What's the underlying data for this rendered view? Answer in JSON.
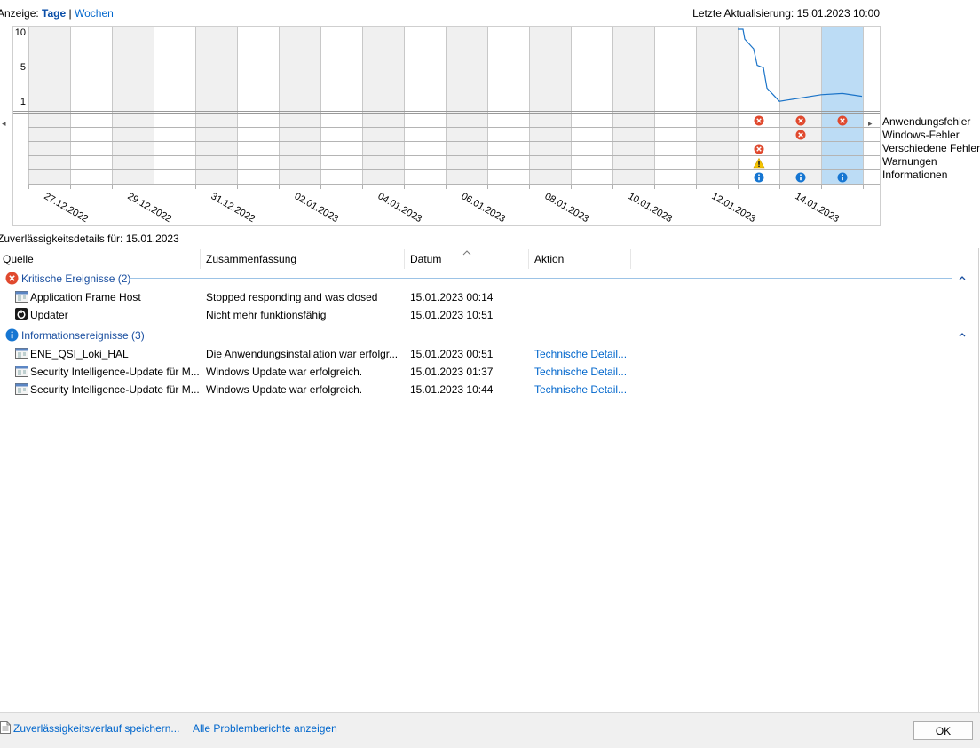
{
  "header": {
    "view_label": "Anzeige:",
    "view_days": "Tage",
    "view_sep": "|",
    "view_weeks": "Wochen",
    "last_update": "Letzte Aktualisierung: 15.01.2023 10:00"
  },
  "chart": {
    "y_labels": [
      "10",
      "5",
      "1"
    ],
    "legend": [
      "Anwendungsfehler",
      "Windows-Fehler",
      "Verschiedene Fehler",
      "Warnungen",
      "Informationen"
    ],
    "date_labels": [
      "27.12.2022",
      "29.12.2022",
      "31.12.2022",
      "02.01.2023",
      "04.01.2023",
      "06.01.2023",
      "08.01.2023",
      "10.01.2023",
      "12.01.2023",
      "14.01.2023"
    ],
    "nav_left": "◂",
    "nav_right": "▸",
    "selected_day": "15.01.2023",
    "line_color": "#1a73c8",
    "selection_color": "#bcdcf5"
  },
  "chart_data": {
    "type": "line",
    "title": "",
    "xlabel": "",
    "ylabel": "",
    "ylim": [
      1,
      10
    ],
    "x": [
      "13.01.2023",
      "14.01.2023",
      "15.01.2023"
    ],
    "series": [
      {
        "values": [
          10.0,
          1.2,
          2.0
        ]
      }
    ],
    "event_markers": [
      {
        "day": "13.01.2023",
        "events": [
          "Anwendungsfehler",
          "Verschiedene Fehler",
          "Warnungen",
          "Informationen"
        ]
      },
      {
        "day": "14.01.2023",
        "events": [
          "Anwendungsfehler",
          "Windows-Fehler",
          "Informationen"
        ]
      },
      {
        "day": "15.01.2023",
        "events": [
          "Anwendungsfehler",
          "Informationen"
        ]
      }
    ]
  },
  "details": {
    "title": "Zuverlässigkeitsdetails für: 15.01.2023",
    "columns": [
      "Quelle",
      "Zusammenfassung",
      "Datum",
      "Aktion"
    ],
    "groups": [
      {
        "label": "Kritische Ereignisse (2)",
        "icon": "error-icon",
        "rows": [
          {
            "icon": "app-window-icon",
            "source": "Application Frame Host",
            "summary": "Stopped responding and was closed",
            "date": "15.01.2023 00:14",
            "action": ""
          },
          {
            "icon": "updater-icon",
            "source": "Updater",
            "summary": "Nicht mehr funktionsfähig",
            "date": "15.01.2023 10:51",
            "action": ""
          }
        ]
      },
      {
        "label": "Informationsereignisse (3)",
        "icon": "info-icon",
        "rows": [
          {
            "icon": "app-window-icon",
            "source": "ENE_QSI_Loki_HAL",
            "summary": "Die Anwendungsinstallation war erfolgr...",
            "date": "15.01.2023 00:51",
            "action": "Technische Detail..."
          },
          {
            "icon": "app-window-icon",
            "source": "Security Intelligence-Update für M...",
            "summary": "Windows Update war erfolgreich.",
            "date": "15.01.2023 01:37",
            "action": "Technische Detail..."
          },
          {
            "icon": "app-window-icon",
            "source": "Security Intelligence-Update für M...",
            "summary": "Windows Update war erfolgreich.",
            "date": "15.01.2023 10:44",
            "action": "Technische Detail..."
          }
        ]
      }
    ]
  },
  "footer": {
    "save_link": "Zuverlässigkeitsverlauf speichern...",
    "reports_link": "Alle Problemberichte anzeigen",
    "ok_label": "OK"
  }
}
